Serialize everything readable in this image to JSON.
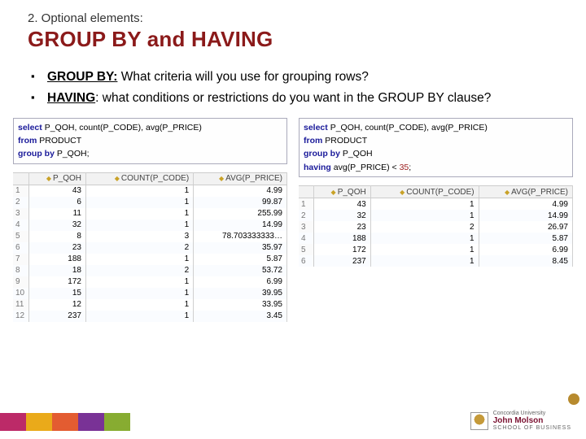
{
  "header": {
    "section": "2. Optional elements:",
    "title": "GROUP BY and HAVING"
  },
  "bullets": [
    {
      "term": "GROUP BY:",
      "desc": " What criteria will you use for grouping rows?"
    },
    {
      "term": "HAVING",
      "desc": ": what conditions or restrictions do you want in the GROUP BY clause?"
    }
  ],
  "left": {
    "sql": {
      "select": "select",
      "cols": " P_QOH, count(P_CODE), avg(P_PRICE)",
      "from": "from",
      "tbl": " PRODUCT",
      "groupby": "group by",
      "gcol": " P_QOH;"
    },
    "columns": [
      "P_QOH",
      "COUNT(P_CODE)",
      "AVG(P_PRICE)"
    ],
    "rows": [
      [
        "43",
        "1",
        "4.99"
      ],
      [
        "6",
        "1",
        "99.87"
      ],
      [
        "11",
        "1",
        "255.99"
      ],
      [
        "32",
        "1",
        "14.99"
      ],
      [
        "8",
        "3",
        "78.703333333…"
      ],
      [
        "23",
        "2",
        "35.97"
      ],
      [
        "188",
        "1",
        "5.87"
      ],
      [
        "18",
        "2",
        "53.72"
      ],
      [
        "172",
        "1",
        "6.99"
      ],
      [
        "15",
        "1",
        "39.95"
      ],
      [
        "12",
        "1",
        "33.95"
      ],
      [
        "237",
        "1",
        "3.45"
      ]
    ]
  },
  "right": {
    "sql": {
      "select": "select",
      "cols": " P_QOH, count(P_CODE), avg(P_PRICE)",
      "from": "from",
      "tbl": " PRODUCT",
      "groupby": "group by",
      "gcol": " P_QOH",
      "having": "having",
      "hcol": " avg(P_PRICE) < ",
      "hval": "35",
      "end": ";"
    },
    "columns": [
      "P_QOH",
      "COUNT(P_CODE)",
      "AVG(P_PRICE)"
    ],
    "rows": [
      [
        "43",
        "1",
        "4.99"
      ],
      [
        "32",
        "1",
        "14.99"
      ],
      [
        "23",
        "2",
        "26.97"
      ],
      [
        "188",
        "1",
        "5.87"
      ],
      [
        "172",
        "1",
        "6.99"
      ],
      [
        "237",
        "1",
        "8.45"
      ]
    ]
  },
  "logo": {
    "l1": "Concordia University",
    "l2": "John Molson",
    "l3": "SCHOOL OF BUSINESS"
  },
  "slidenum": ""
}
